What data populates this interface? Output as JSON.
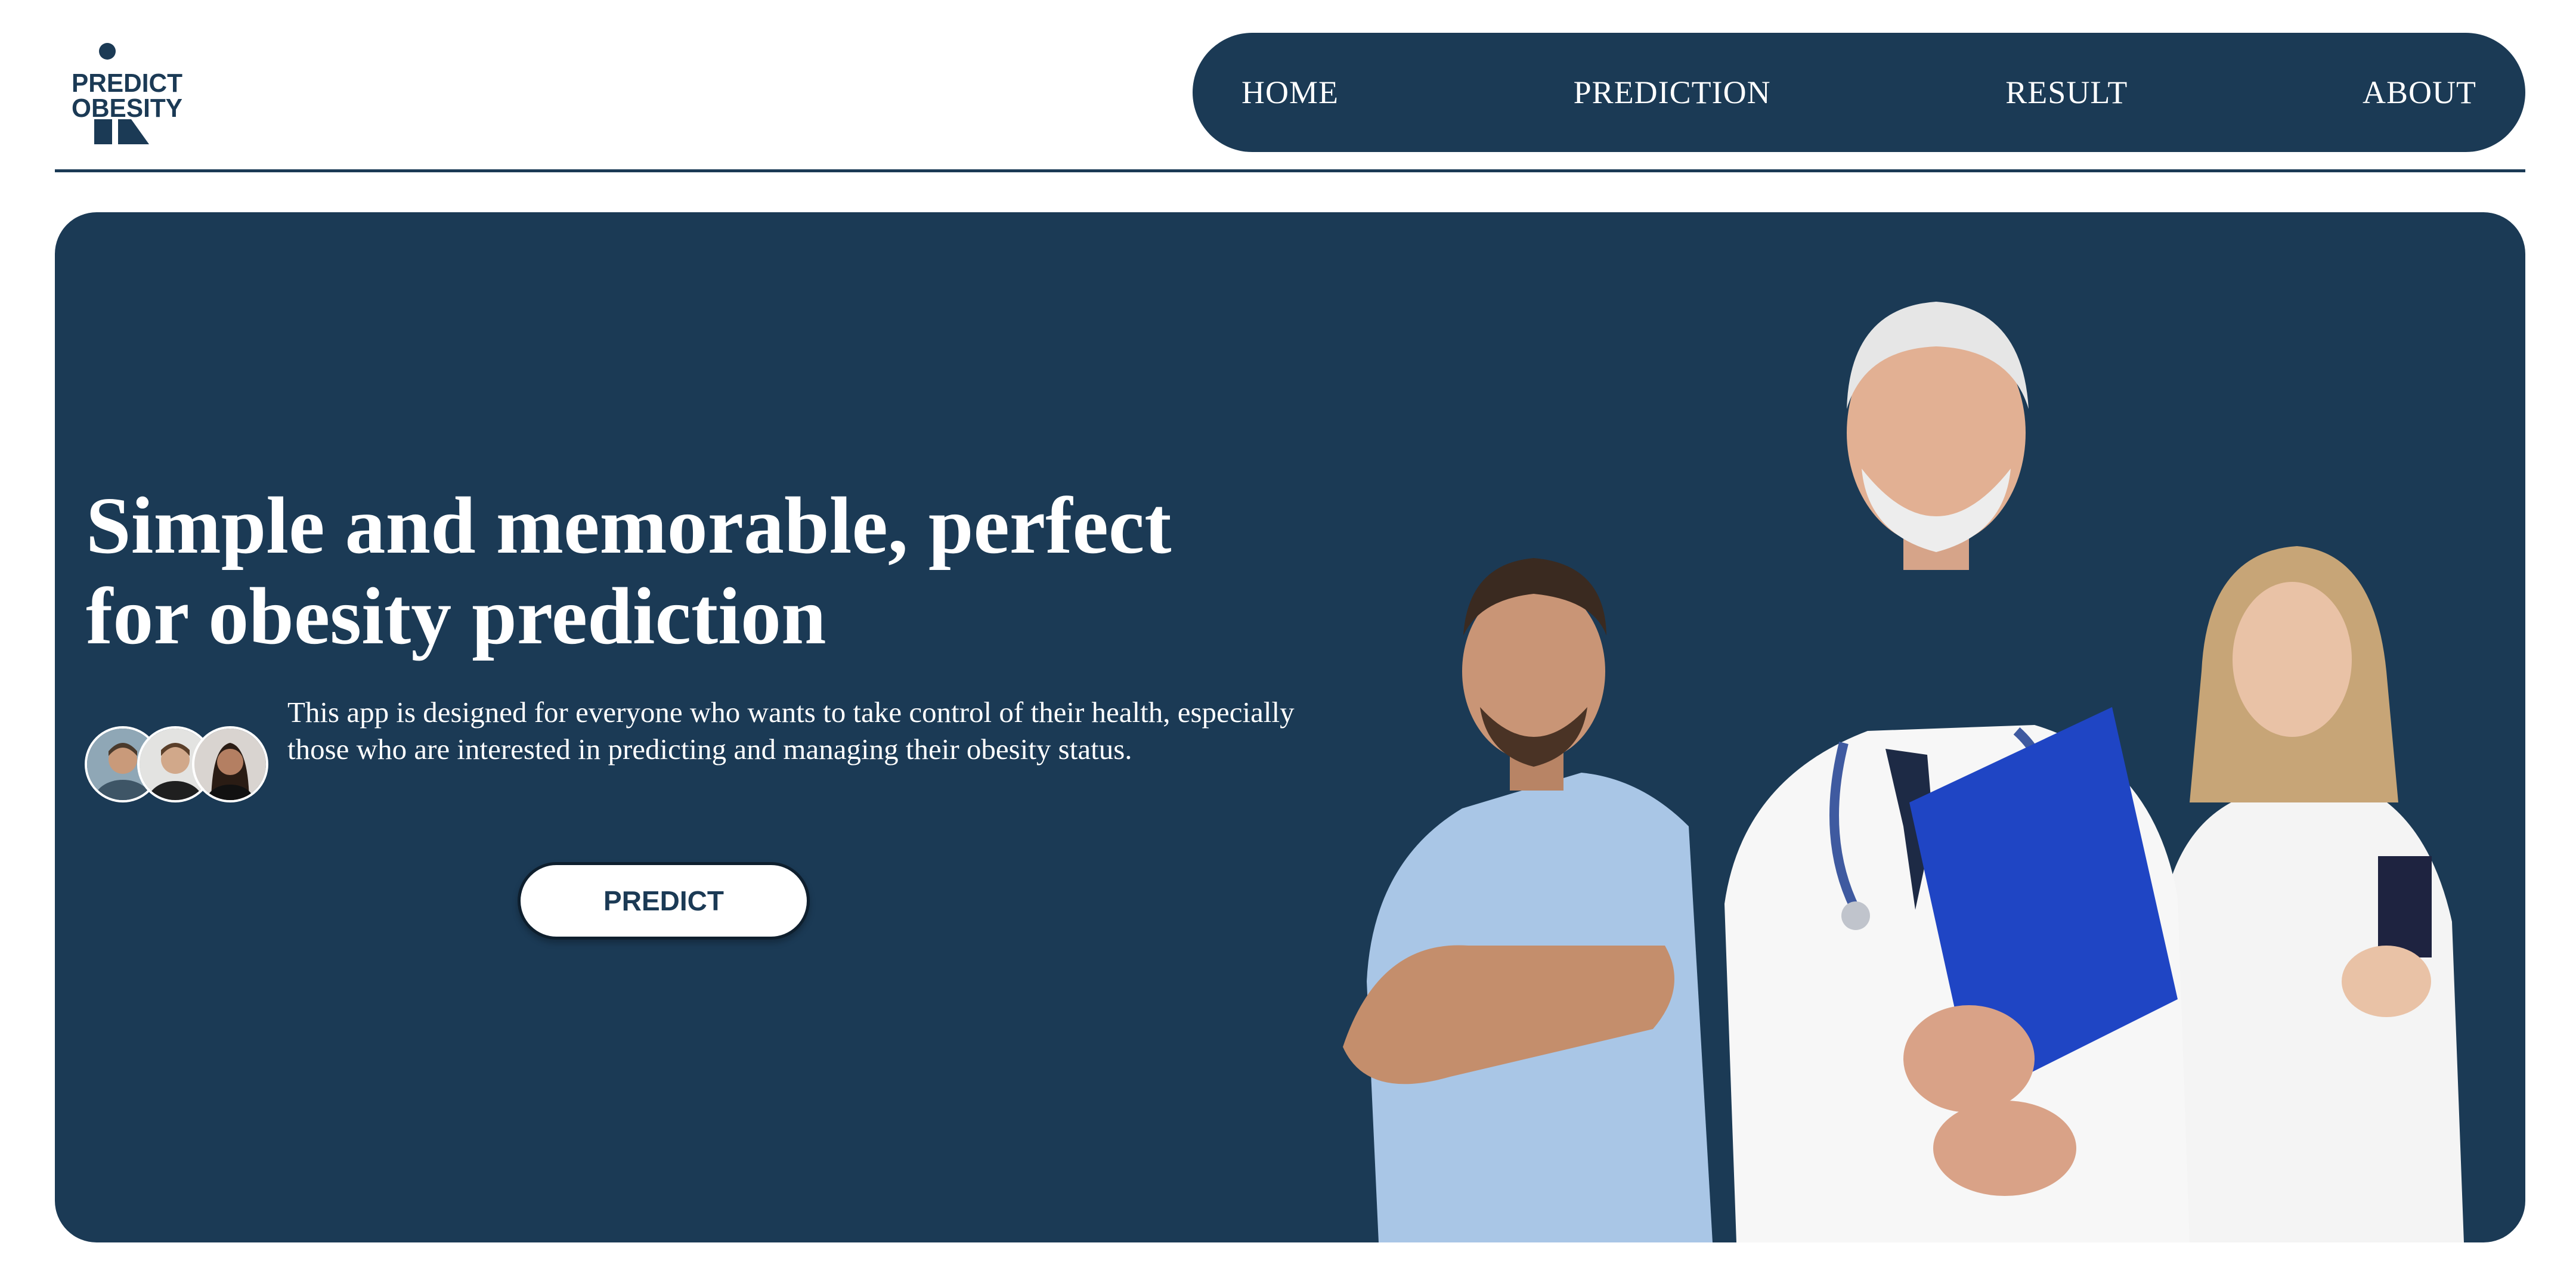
{
  "brand": {
    "logo_line1": "PREDICT",
    "logo_line2": "OBESITY",
    "color": "#1b3a55"
  },
  "nav": {
    "items": [
      {
        "label": "HOME"
      },
      {
        "label": "PREDICTION"
      },
      {
        "label": "RESULT"
      },
      {
        "label": "ABOUT"
      }
    ]
  },
  "hero": {
    "title_line1": "Simple and memorable, perfect",
    "title_line2": "for obesity prediction",
    "description": "This app is designed for everyone who wants to take control of their health, especially those who are interested in predicting and managing their obesity status.",
    "cta_label": "PREDICT",
    "avatars": [
      "user-avatar-1",
      "user-avatar-2",
      "user-avatar-3"
    ],
    "image": "medical-team-photo"
  },
  "colors": {
    "primary": "#1b3a55",
    "background": "#ffffff",
    "text_on_primary": "#ffffff"
  }
}
